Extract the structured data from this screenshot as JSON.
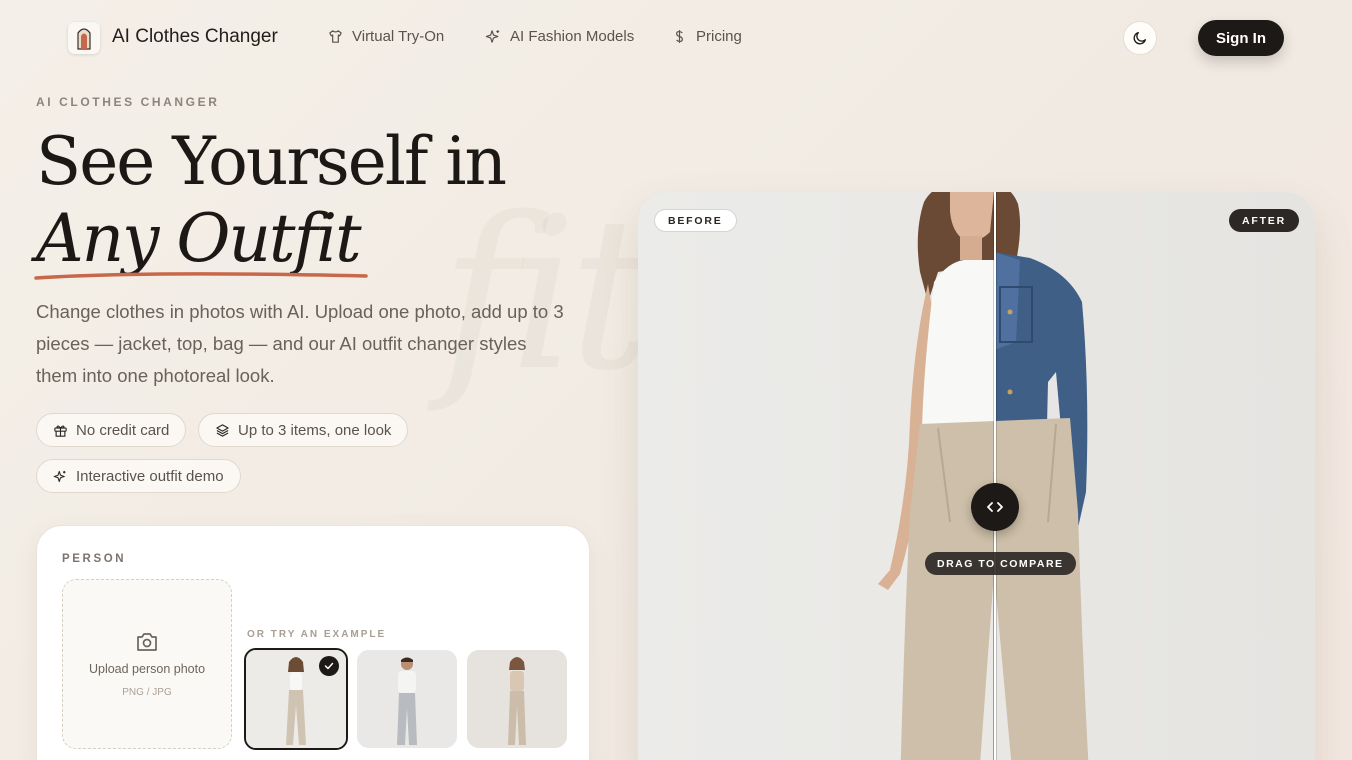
{
  "header": {
    "brand": "AI Clothes Changer",
    "nav": [
      {
        "label": "Virtual Try-On",
        "icon": "shirt-icon"
      },
      {
        "label": "AI Fashion Models",
        "icon": "sparkles-icon"
      },
      {
        "label": "Pricing",
        "icon": "dollar-icon"
      }
    ],
    "sign_in": "Sign In"
  },
  "hero": {
    "eyebrow": "AI CLOTHES CHANGER",
    "title_line1": "See Yourself in",
    "title_line2": "Any Outfit",
    "ghost_word": "fit",
    "lead": "Change clothes in photos with AI. Upload one photo, add up to 3 pieces — jacket, top, bag — and our AI outfit changer styles them into one photoreal look.",
    "chips": [
      {
        "label": "No credit card",
        "icon": "gift-icon"
      },
      {
        "label": "Up to 3 items, one look",
        "icon": "layers-icon"
      },
      {
        "label": "Interactive outfit demo",
        "icon": "sparkles-icon"
      }
    ]
  },
  "person_card": {
    "label": "PERSON",
    "upload_title": "Upload person photo",
    "upload_formats": "PNG / JPG",
    "examples_label": "OR TRY AN EXAMPLE",
    "selected_example": 1
  },
  "compare": {
    "before_label": "BEFORE",
    "after_label": "AFTER",
    "drag_hint": "DRAG TO COMPARE"
  },
  "colors": {
    "accent": "#c8684a",
    "dark": "#1d1917",
    "denim": "#3f5f87"
  }
}
